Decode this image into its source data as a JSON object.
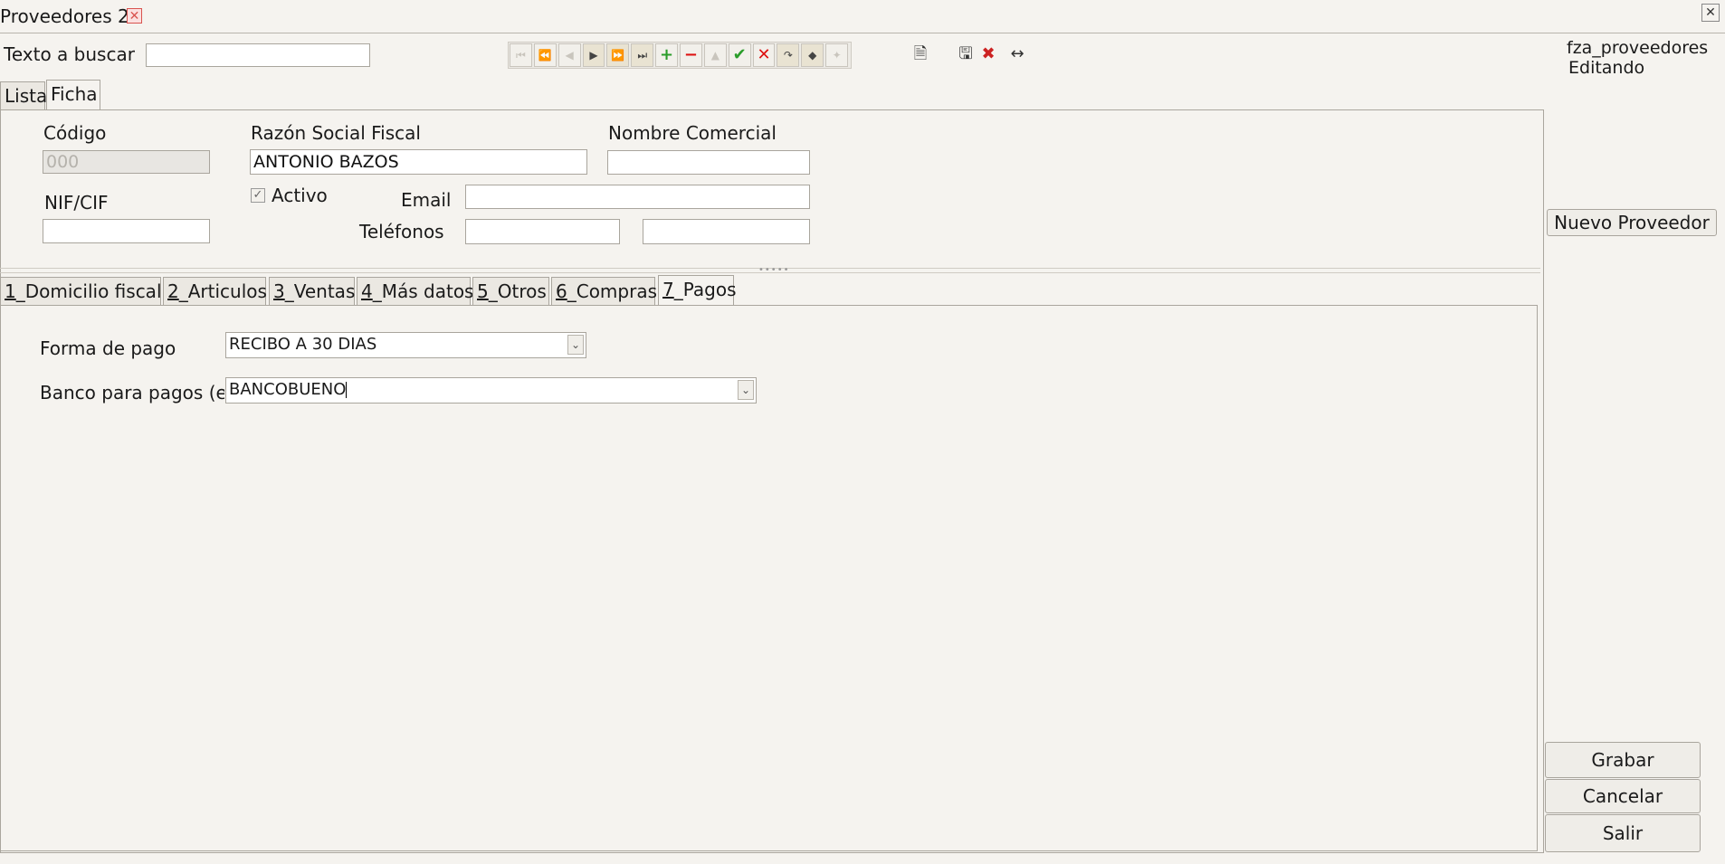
{
  "window": {
    "tab_title": "Proveedores 2",
    "close_glyph": "✕"
  },
  "search": {
    "label": "Texto a buscar",
    "value": ""
  },
  "toolbar": {
    "buttons": [
      {
        "icon": "first-record-icon",
        "glyph": "⏮",
        "state": "disabled"
      },
      {
        "icon": "prev-page-icon",
        "glyph": "⏪",
        "state": "disabled"
      },
      {
        "icon": "prev-record-icon",
        "glyph": "◀",
        "state": "disabled"
      },
      {
        "icon": "next-record-icon",
        "glyph": "▶",
        "state": "on"
      },
      {
        "icon": "next-page-icon",
        "glyph": "⏩",
        "state": "on"
      },
      {
        "icon": "last-record-icon",
        "glyph": "⏭",
        "state": "on"
      },
      {
        "icon": "add-icon",
        "glyph": "+",
        "state": "green"
      },
      {
        "icon": "delete-icon",
        "glyph": "−",
        "state": "red"
      },
      {
        "icon": "up-icon",
        "glyph": "▲",
        "state": "disabled"
      },
      {
        "icon": "accept-icon",
        "glyph": "✔",
        "state": "green"
      },
      {
        "icon": "cancel-icon",
        "glyph": "✕",
        "state": "red"
      },
      {
        "icon": "redo-icon",
        "glyph": "↷",
        "state": "on"
      },
      {
        "icon": "pin-icon",
        "glyph": "◆",
        "state": "on"
      },
      {
        "icon": "magic-icon",
        "glyph": "✦",
        "state": "disabled"
      }
    ],
    "extra_icons": [
      {
        "icon": "export-icon",
        "glyph": "🗎"
      },
      {
        "icon": "save-icon",
        "glyph": "🖫"
      },
      {
        "icon": "discard-icon",
        "glyph": "✖"
      },
      {
        "icon": "resize-icon",
        "glyph": "↔"
      }
    ]
  },
  "status": {
    "form_name": "fza_proveedores",
    "mode": "Editando"
  },
  "view_tabs": [
    {
      "label": "Lista"
    },
    {
      "label": "Ficha"
    }
  ],
  "form": {
    "codigo_label": "Código",
    "codigo_value": "000",
    "razon_label": "Razón Social Fiscal",
    "razon_value": "ANTONIO BAZOS",
    "nombre_label": "Nombre Comercial",
    "nombre_value": "",
    "nif_label": "NIF/CIF",
    "nif_value": "",
    "activo_label": "Activo",
    "activo_checked": true,
    "email_label": "Email",
    "email_value": "",
    "telefonos_label": "Teléfonos",
    "telefono1_value": "",
    "telefono2_value": ""
  },
  "nuevo_button": "Nuevo Proveedor",
  "sub_tabs": [
    {
      "num": "1",
      "label": "_Domicilio fiscal"
    },
    {
      "num": "2",
      "label": "_Articulos"
    },
    {
      "num": "3",
      "label": "_Ventas"
    },
    {
      "num": "4",
      "label": "_Más datos"
    },
    {
      "num": "5",
      "label": "_Otros"
    },
    {
      "num": "6",
      "label": "_Compras"
    },
    {
      "num": "7",
      "label": "_Pagos"
    }
  ],
  "pagos": {
    "forma_label": "Forma de pago",
    "forma_value": "RECIBO A 30 DIAS",
    "banco_label": "Banco para pagos (em",
    "banco_value": "BANCOBUENO"
  },
  "actions": {
    "grabar": "Grabar",
    "cancelar": "Cancelar",
    "salir": "Salir"
  },
  "arrow_glyph": "⌄"
}
